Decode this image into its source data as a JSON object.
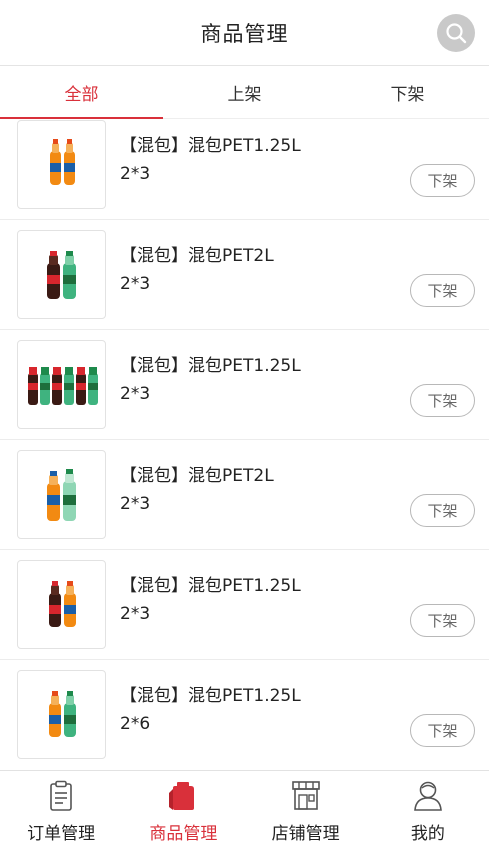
{
  "header": {
    "title": "商品管理",
    "search_icon": "search-icon"
  },
  "tabs": [
    {
      "label": "全部",
      "active": true
    },
    {
      "label": "上架",
      "active": false
    },
    {
      "label": "下架",
      "active": false
    }
  ],
  "products": [
    {
      "name": "【混包】混包PET1.25L",
      "spec": "2*3",
      "action": "下架"
    },
    {
      "name": "【混包】混包PET2L",
      "spec": "2*3",
      "action": "下架"
    },
    {
      "name": "【混包】混包PET1.25L",
      "spec": "2*3",
      "action": "下架"
    },
    {
      "name": "【混包】混包PET2L",
      "spec": "2*3",
      "action": "下架"
    },
    {
      "name": "【混包】混包PET1.25L",
      "spec": "2*3",
      "action": "下架"
    },
    {
      "name": "【混包】混包PET1.25L",
      "spec": "2*6",
      "action": "下架"
    }
  ],
  "bottom_nav": [
    {
      "label": "订单管理",
      "icon": "clipboard-icon",
      "active": false
    },
    {
      "label": "商品管理",
      "icon": "tag-icon",
      "active": true
    },
    {
      "label": "店铺管理",
      "icon": "store-icon",
      "active": false
    },
    {
      "label": "我的",
      "icon": "user-icon",
      "active": false
    }
  ],
  "colors": {
    "accent": "#d9303a"
  }
}
